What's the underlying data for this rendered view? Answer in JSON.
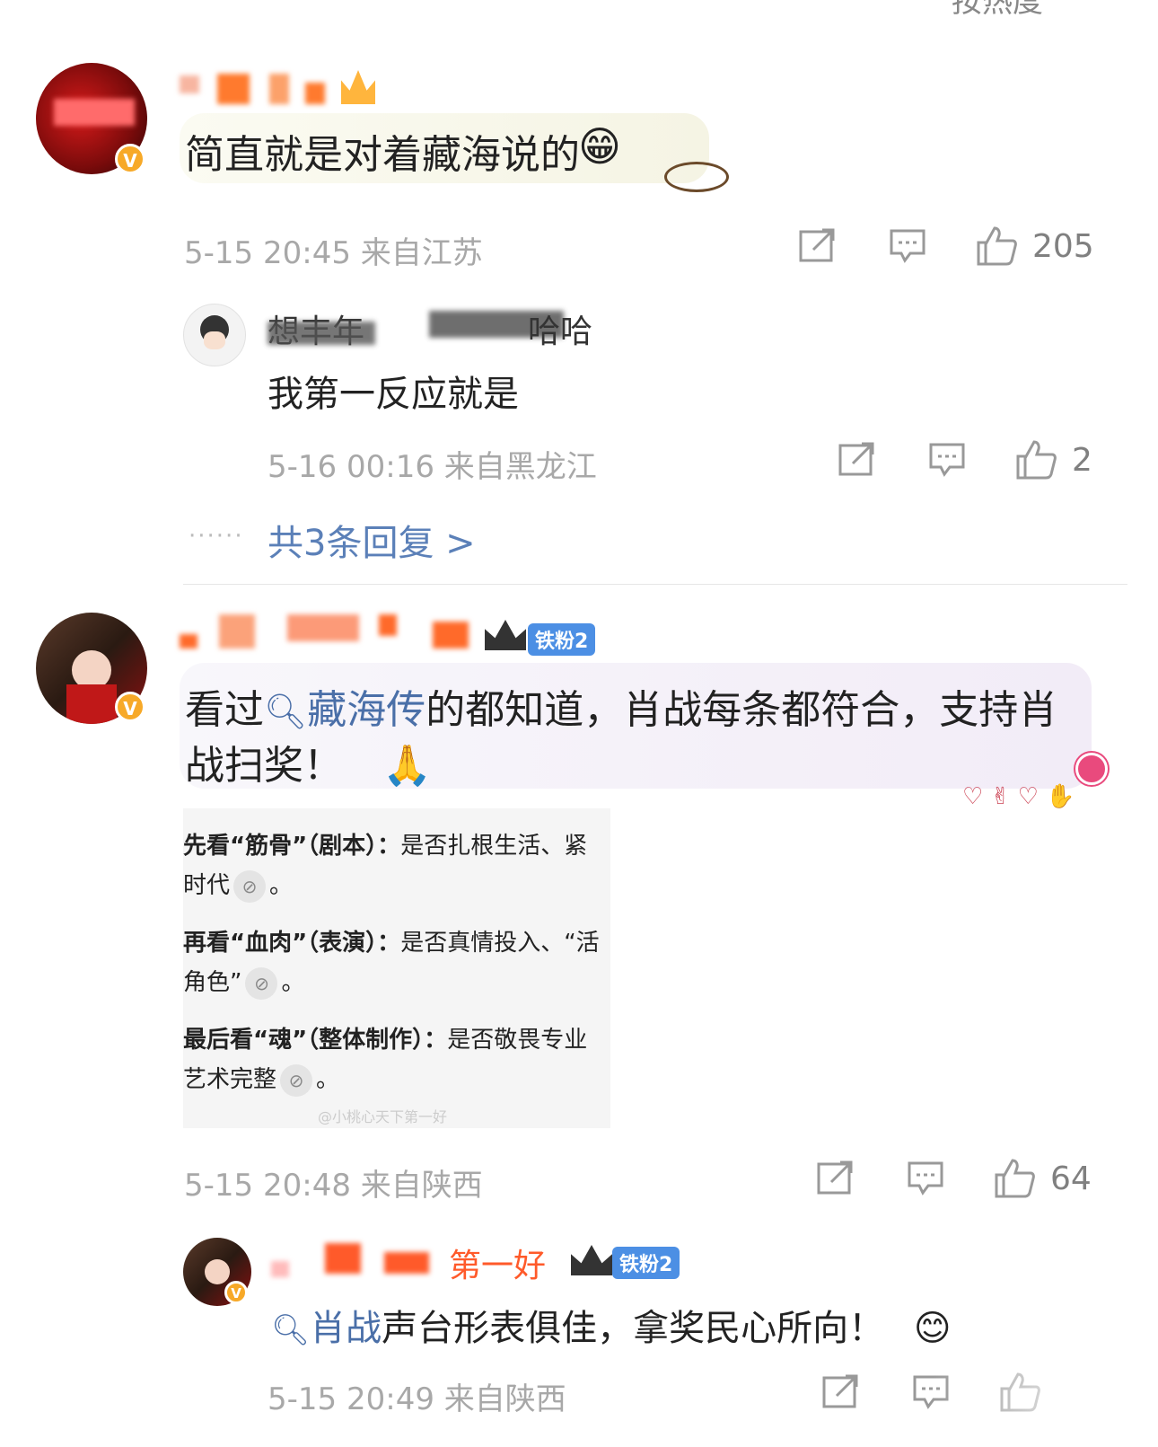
{
  "comments": [
    {
      "text": "简直就是对着藏海说的",
      "emoji": "😁",
      "meta": "5-15 20:45 来自江苏",
      "likes": "205",
      "replies": [
        {
          "name_visible": "想丰年",
          "name_tail": "哈哈",
          "text": "我第一反应就是",
          "meta": "5-16 00:16 来自黑龙江",
          "likes": "2"
        }
      ],
      "more_replies": "共3条回复 >"
    },
    {
      "fan_badge": "铁粉2",
      "text_prefix": "看过",
      "topic": "藏海传",
      "text_line1_rest": "的都知道，肖战每条都符合，支持肖",
      "text_line2": "战扫奖！",
      "emoji": "🙏",
      "embed": {
        "lines": [
          {
            "bold": "先看“筋骨”（剧本）：",
            "rest": "是否扎根生活、紧"
          },
          {
            "bold": "",
            "rest": "时代",
            "tail": "。"
          },
          {
            "bold": "再看“血肉”（表演）：",
            "rest": "是否真情投入、“活"
          },
          {
            "bold": "",
            "rest": "角色”",
            "tail": "。"
          },
          {
            "bold": "最后看“魂”（整体制作）：",
            "rest": "是否敬畏专业"
          },
          {
            "bold": "",
            "rest": "艺术完整",
            "tail": "。"
          }
        ],
        "watermark": "@小桃心天下第一好"
      },
      "meta": "5-15 20:48 来自陕西",
      "likes": "64",
      "replies": [
        {
          "name_visible": "第一好",
          "fan_badge": "铁粉2",
          "topic": "肖战",
          "text_rest": "声台形表俱佳，拿奖民心所向！",
          "emoji": "😊",
          "meta": "5-15 20:49 来自陕西"
        }
      ]
    }
  ],
  "top_partial": "按热度",
  "colors": {
    "link": "#5b80b8",
    "meta": "#a8a8a8",
    "badge": "#f7a928",
    "tiefen": "#4c8fe4"
  }
}
